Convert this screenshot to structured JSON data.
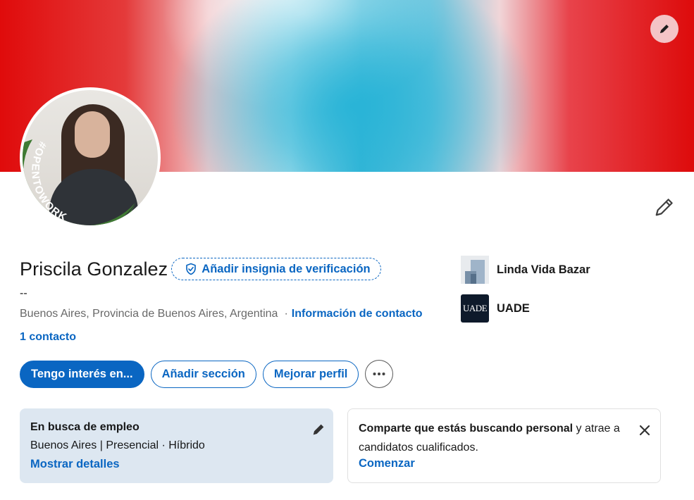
{
  "profile": {
    "name": "Priscila Gonzalez",
    "verify_badge_label": "Añadir insignia de verificación",
    "headline": "--",
    "location": "Buenos Aires, Provincia de Buenos Aires, Argentina",
    "separator": "·",
    "contact_info_label": "Información de contacto",
    "connections_label": "1 contacto",
    "open_to_work_frame": "#OPENTOWORK"
  },
  "organizations": [
    {
      "name": "Linda Vida Bazar",
      "logo": "building-placeholder-icon"
    },
    {
      "name": "UADE",
      "logo_text": "UADE"
    }
  ],
  "actions": {
    "primary_label": "Tengo interés en...",
    "add_section_label": "Añadir sección",
    "improve_profile_label": "Mejorar perfil",
    "more_icon": "more-horizontal-icon"
  },
  "open_to_work_card": {
    "title": "En busca de empleo",
    "details": "Buenos Aires | Presencial · Híbrido",
    "link_label": "Mostrar detalles"
  },
  "hiring_card": {
    "text_bold": "Comparte que estás buscando personal",
    "text_rest": " y atrae a candidatos cualificados.",
    "link_label": "Comenzar"
  },
  "colors": {
    "accent": "#0a66c2",
    "open_to_work_green": "#3f7a33",
    "card_blue": "#dde7f1"
  }
}
